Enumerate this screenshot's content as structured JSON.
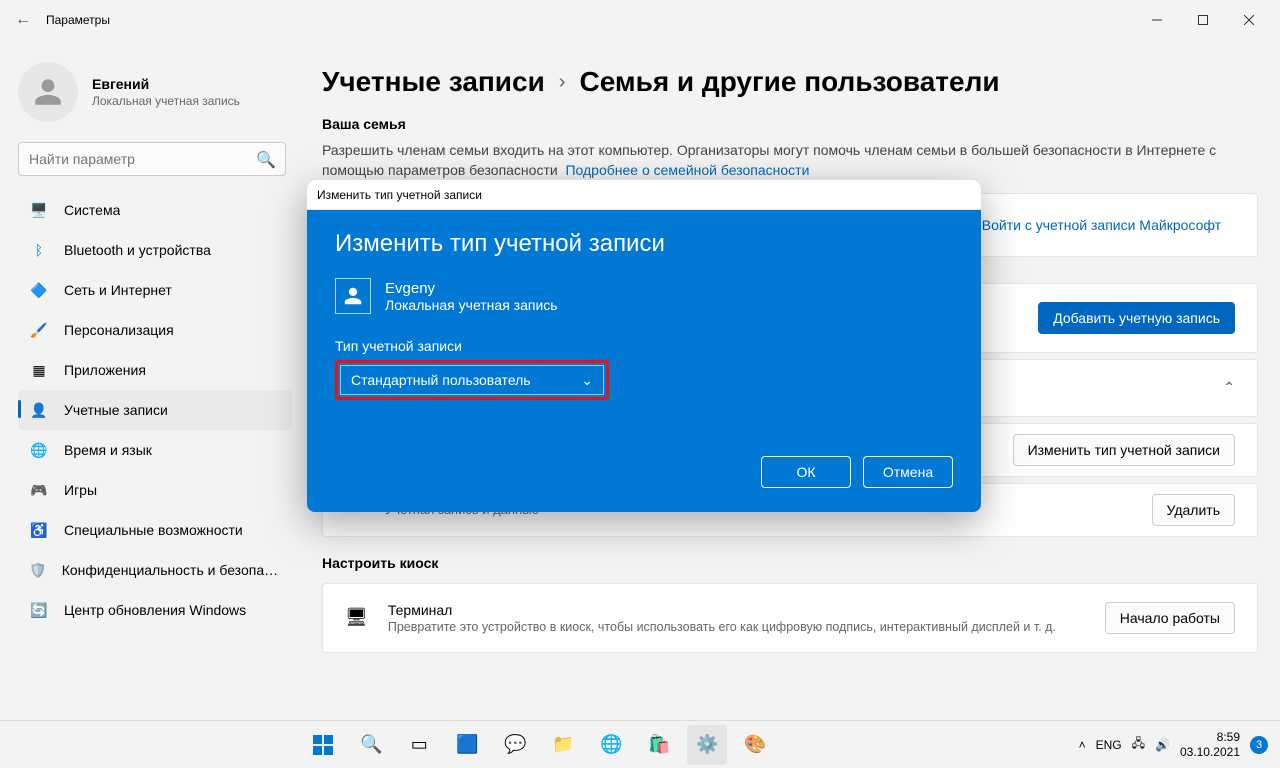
{
  "window": {
    "title": "Параметры"
  },
  "user": {
    "name": "Евгений",
    "subtitle": "Локальная учетная запись"
  },
  "search": {
    "placeholder": "Найти параметр"
  },
  "nav": [
    {
      "label": "Система",
      "icon": "🖥️"
    },
    {
      "label": "Bluetooth и устройства",
      "icon": "ᛒ"
    },
    {
      "label": "Сеть и Интернет",
      "icon": "🔷"
    },
    {
      "label": "Персонализация",
      "icon": "🖌️"
    },
    {
      "label": "Приложения",
      "icon": "▦"
    },
    {
      "label": "Учетные записи",
      "icon": "👤"
    },
    {
      "label": "Время и язык",
      "icon": "🌐"
    },
    {
      "label": "Игры",
      "icon": "🎮"
    },
    {
      "label": "Специальные возможности",
      "icon": "♿"
    },
    {
      "label": "Конфиденциальность и безопасность",
      "icon": "🛡️"
    },
    {
      "label": "Центр обновления Windows",
      "icon": "🔄"
    }
  ],
  "breadcrumb": {
    "parent": "Учетные записи",
    "current": "Семья и другие пользователи"
  },
  "family": {
    "heading": "Ваша семья",
    "desc": "Разрешить членам семьи входить на этот компьютер. Организаторы могут помочь членам семьи в большей безопасности в Интернете с помощью параметров безопасности",
    "link": "Подробнее о семейной безопасности",
    "signin_btn": "Войти с учетной записи Майкрософт"
  },
  "other_users": {
    "add_btn": "Добавить учетную запись",
    "change_type_btn": "Изменить тип учетной записи",
    "account_data_label": "Учетная запись и данные",
    "delete_btn": "Удалить"
  },
  "kiosk": {
    "heading": "Настроить киоск",
    "title": "Терминал",
    "desc": "Превратите это устройство в киоск, чтобы использовать его как цифровую подпись, интерактивный дисплей и т. д.",
    "start_btn": "Начало работы"
  },
  "dialog": {
    "window_title": "Изменить тип учетной записи",
    "heading": "Изменить тип учетной записи",
    "user_name": "Evgeny",
    "user_sub": "Локальная учетная запись",
    "type_label": "Тип учетной записи",
    "selected_type": "Стандартный пользователь",
    "ok": "ОК",
    "cancel": "Отмена"
  },
  "taskbar": {
    "lang": "ENG",
    "time": "8:59",
    "date": "03.10.2021",
    "badge": "3"
  }
}
